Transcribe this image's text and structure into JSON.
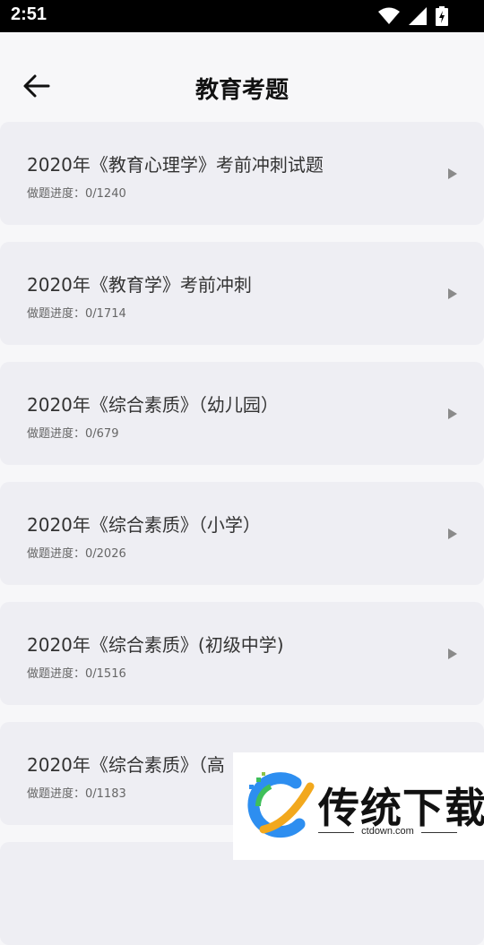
{
  "status_bar": {
    "time": "2:51",
    "icons": [
      "wifi-icon",
      "signal-icon",
      "battery-charging-icon"
    ]
  },
  "header": {
    "title": "教育考题",
    "back_icon": "arrow-left-icon"
  },
  "items": [
    {
      "title": "2020年《教育心理学》考前冲刺试题",
      "progress": "做题进度：0/1240"
    },
    {
      "title": "2020年《教育学》考前冲刺",
      "progress": "做题进度：0/1714"
    },
    {
      "title": "2020年《综合素质》（幼儿园）",
      "progress": "做题进度：0/679"
    },
    {
      "title": "2020年《综合素质》（小学）",
      "progress": "做题进度：0/2026"
    },
    {
      "title": "2020年《综合素质》(初级中学)",
      "progress": "做题进度：0/1516"
    },
    {
      "title": "2020年《综合素质》（高",
      "progress": "做题进度：0/1183"
    }
  ],
  "watermark": {
    "text": "传统下载",
    "url": "ctdown.com"
  },
  "colors": {
    "background": "#f7f7f9",
    "card": "#eeeef3",
    "arrow": "#8a8a8a"
  }
}
